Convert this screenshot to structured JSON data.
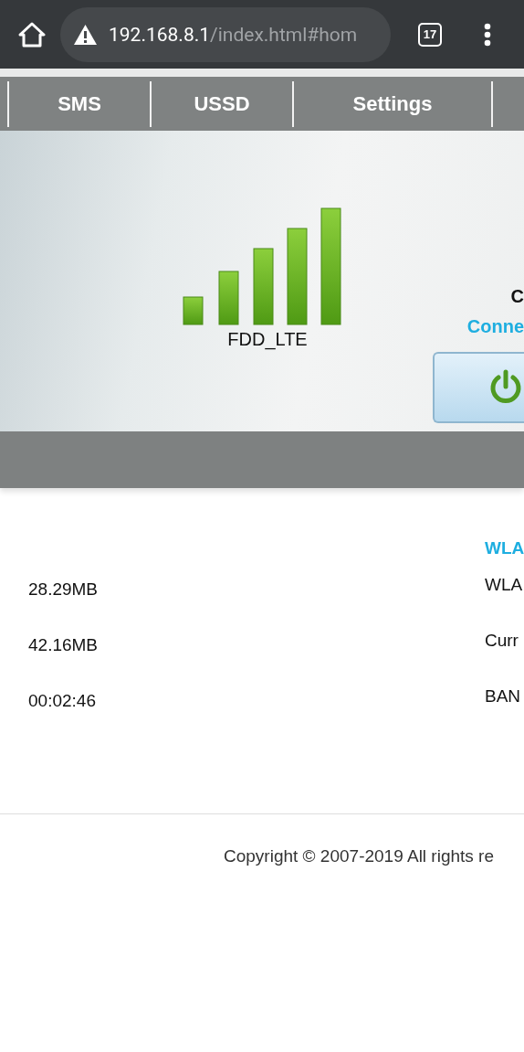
{
  "browser": {
    "url_host": "192.168.8.1",
    "url_path": "/index.html#hom",
    "tab_count": "17",
    "insecure": true
  },
  "nav": {
    "tabs": [
      {
        "label": "SMS",
        "selected": false
      },
      {
        "label": "USSD",
        "selected": false
      },
      {
        "label": "Settings",
        "selected": false
      }
    ]
  },
  "hero": {
    "network_type": "FDD_LTE",
    "status_title": "C",
    "status_text": "Conne",
    "connected": true
  },
  "info": {
    "heading": "WLA",
    "rows": [
      {
        "value": "28.29MB",
        "label": "WLA"
      },
      {
        "value": "42.16MB",
        "label": "Curr"
      },
      {
        "value": "00:02:46",
        "label": "BAN"
      }
    ]
  },
  "footer": {
    "copyright": "Copyright © 2007-2019 All rights re"
  }
}
